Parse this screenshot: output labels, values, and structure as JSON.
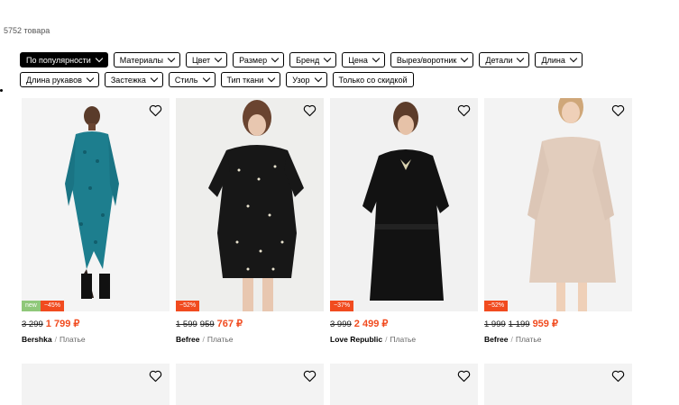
{
  "results_count": "5752 товара",
  "filters_row1": [
    {
      "label": "По популярности",
      "active": true
    },
    {
      "label": "Материалы",
      "active": false
    },
    {
      "label": "Цвет",
      "active": false
    },
    {
      "label": "Размер",
      "active": false
    },
    {
      "label": "Бренд",
      "active": false
    },
    {
      "label": "Цена",
      "active": false
    },
    {
      "label": "Вырез/воротник",
      "active": false
    },
    {
      "label": "Детали",
      "active": false
    },
    {
      "label": "Длина",
      "active": false
    }
  ],
  "filters_row2": [
    {
      "label": "Длина рукавов",
      "chevron": true
    },
    {
      "label": "Застежка",
      "chevron": true
    },
    {
      "label": "Стиль",
      "chevron": true
    },
    {
      "label": "Тип ткани",
      "chevron": true
    },
    {
      "label": "Узор",
      "chevron": true
    },
    {
      "label": "Только со скидкой",
      "chevron": false
    }
  ],
  "products": [
    {
      "brand": "Bershka",
      "category": "Платье",
      "old_prices": [
        "3 299"
      ],
      "price": "1 799 ₽",
      "new_badge": "new",
      "discount": "−45%",
      "image": "teal-floral-dress"
    },
    {
      "brand": "Befree",
      "category": "Платье",
      "old_prices": [
        "1 599",
        "959"
      ],
      "price": "767 ₽",
      "new_badge": "",
      "discount": "−52%",
      "image": "black-polka-dress"
    },
    {
      "brand": "Love Republic",
      "category": "Платье",
      "old_prices": [
        "3 999"
      ],
      "price": "2 499 ₽",
      "new_badge": "",
      "discount": "−37%",
      "image": "black-collar-dress"
    },
    {
      "brand": "Befree",
      "category": "Платье",
      "old_prices": [
        "1 999",
        "1 199"
      ],
      "price": "959 ₽",
      "new_badge": "",
      "discount": "−52%",
      "image": "beige-dress"
    }
  ],
  "colors": {
    "accent": "#f14b1f",
    "new_badge": "#8fc87a"
  }
}
